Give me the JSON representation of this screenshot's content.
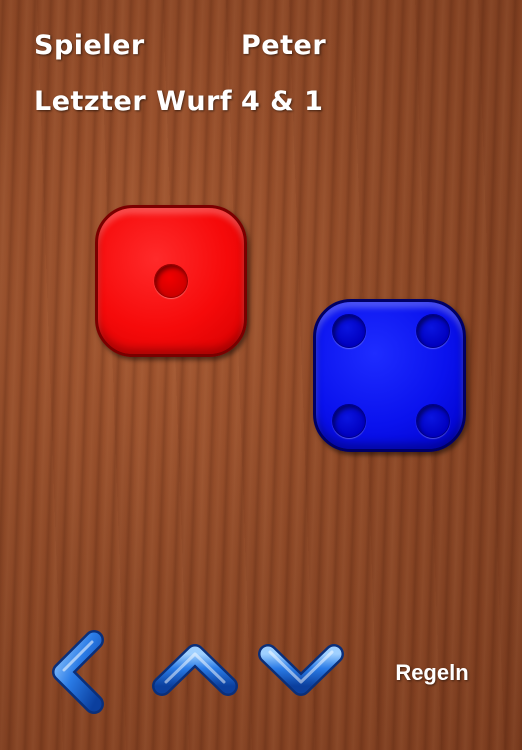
{
  "info": {
    "player_label": "Spieler",
    "player_value": "Peter",
    "last_roll_label": "Letzter Wurf",
    "last_roll_value": "4 & 1"
  },
  "dice": [
    {
      "color": "red",
      "value": 1
    },
    {
      "color": "blue",
      "value": 4
    }
  ],
  "controls": {
    "back_icon": "chevron-left-icon",
    "up_icon": "chevron-up-icon",
    "down_icon": "chevron-down-icon",
    "rules_label": "Regeln"
  },
  "colors": {
    "red_die": "#f60a0a",
    "blue_die": "#0a12ee",
    "chevron": "#1f6fe0",
    "text": "#ffffff"
  }
}
